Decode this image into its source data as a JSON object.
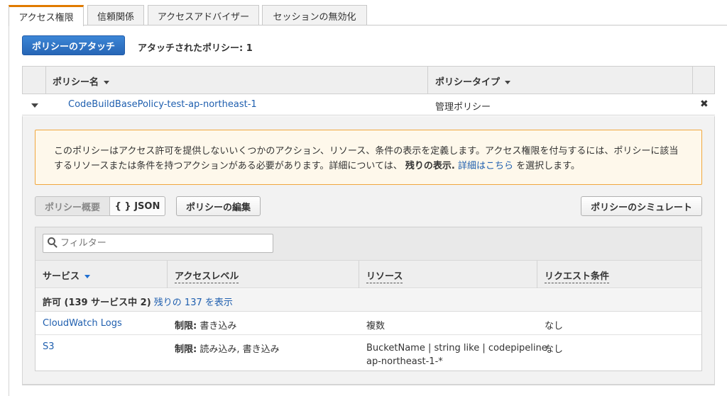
{
  "tabs": [
    {
      "label": "アクセス権限",
      "active": true
    },
    {
      "label": "信頼関係",
      "active": false
    },
    {
      "label": "アクセスアドバイザー",
      "active": false
    },
    {
      "label": "セッションの無効化",
      "active": false
    }
  ],
  "toolbar": {
    "attach_label": "ポリシーのアタッチ",
    "attached_count": "アタッチされたポリシー: 1"
  },
  "policy_table": {
    "col_name": "ポリシー名",
    "col_type": "ポリシータイプ",
    "rows": [
      {
        "name": "CodeBuildBasePolicy-test-ap-northeast-1",
        "type": "管理ポリシー"
      }
    ],
    "remove_glyph": "✖"
  },
  "alert": {
    "line1": "このポリシーはアクセス許可を提供しないいくつかのアクション、リソース、条件の表示を定義します。アクセス権限を付与するには、ポリシーに該当",
    "line2_a": "するリソースまたは条件を持つアクションがある必要があります。詳細については、",
    "line2_bold": "残りの表示.",
    "line2_link": "詳細はこちら",
    "line2_b": "を選択します。"
  },
  "view_toggle": {
    "summary_label": "ポリシー概要",
    "json_label": "{ } JSON"
  },
  "actions": {
    "edit_label": "ポリシーの編集",
    "simulate_label": "ポリシーのシミュレート"
  },
  "filter": {
    "placeholder": "フィルター"
  },
  "service_table": {
    "headers": [
      "サービス",
      "アクセスレベル",
      "リソース",
      "リクエスト条件"
    ],
    "group_text": "許可 (139 サービス中 2)",
    "group_link": "残りの 137 を表示",
    "rows": [
      {
        "service": "CloudWatch Logs",
        "level_bold": "制限:",
        "level": "書き込み",
        "resource": "複数",
        "resource_2": "",
        "condition": "なし"
      },
      {
        "service": "S3",
        "level_bold": "制限:",
        "level": "読み込み, 書き込み",
        "resource": "BucketName | string like | codepipeline-",
        "resource_2": "ap-northeast-1-*",
        "condition": "なし"
      }
    ]
  },
  "colors": {
    "accent": "#e07b00",
    "primary": "#2766b6",
    "link": "#1f5faf",
    "alert_border": "#f0a73e"
  }
}
